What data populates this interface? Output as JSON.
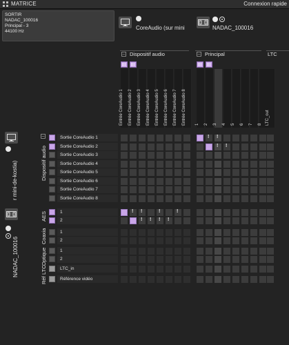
{
  "header": {
    "title": "MATRICE",
    "quick_connect": "Connexion rapide"
  },
  "info_box": {
    "line1": "SORTIR",
    "line2": "NADAC_100016",
    "line3": "Principal - 3",
    "line4": "44100 Hz"
  },
  "top_devices": [
    {
      "name": "CoreAudio (sur mini",
      "icon": "monitor-icon"
    },
    {
      "name": "NADAC_100016",
      "icon": "network-device-icon"
    }
  ],
  "column_groups": {
    "dispositif_audio": {
      "label": "Dispositif audio",
      "columns": [
        "Entrée CoreAudio 1",
        "Entrée CoreAudio 2",
        "Entrée CoreAudio 3",
        "Entrée CoreAudio 4",
        "Entrée CoreAudio 5",
        "Entrée CoreAudio 6",
        "Entrée CoreAudio 7",
        "Entrée CoreAudio 8"
      ]
    },
    "principal": {
      "label": "Principal",
      "columns": [
        "1",
        "2",
        "3",
        "4",
        "5",
        "6",
        "7",
        "8"
      ]
    },
    "ltc": {
      "label": "LTC",
      "columns": [
        "LTC_out"
      ]
    }
  },
  "left_devices": [
    {
      "name": "r mini-de-kostia)",
      "icon": "monitor-icon"
    },
    {
      "name": "NADAC_100016",
      "icon": "network-device-icon"
    }
  ],
  "row_groups": {
    "dispositif_audio": {
      "label": "Dispositif audio",
      "rows": [
        "Sortie CoreAudio 1",
        "Sortie CoreAudio 2",
        "Sortie CoreAudio 3",
        "Sortie CoreAudio 4",
        "Sortie CoreAudio 5",
        "Sortie CoreAudio 6",
        "Sortie CoreAudio 7",
        "Sortie CoreAudio 8"
      ]
    },
    "aes": {
      "label": "AES",
      "rows": [
        "1",
        "2"
      ]
    },
    "coaxial": {
      "label": "Coaxia",
      "rows": [
        "1",
        "2"
      ]
    },
    "optical": {
      "label": "Optique",
      "rows": [
        "1",
        "2"
      ]
    },
    "ltc": {
      "label": "LTC",
      "rows": [
        "LTC_in"
      ]
    },
    "ref": {
      "label": "Réf",
      "rows": [
        "Référence vidéo"
      ]
    }
  },
  "warn_mark": "!",
  "colors": {
    "active": "#c9a6e8",
    "background": "#232323"
  }
}
